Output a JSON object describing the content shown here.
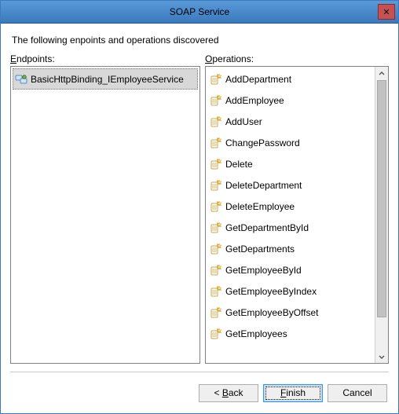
{
  "window": {
    "title": "SOAP Service"
  },
  "intro": "The following enpoints and operations discovered",
  "labels": {
    "endpoints_prefix": "E",
    "endpoints_rest": "ndpoints:",
    "operations_prefix": "O",
    "operations_rest": "perations:"
  },
  "endpoints": {
    "items": [
      {
        "label": "BasicHttpBinding_IEmployeeService",
        "selected": true
      }
    ]
  },
  "operations": {
    "items": [
      {
        "label": "AddDepartment"
      },
      {
        "label": "AddEmployee"
      },
      {
        "label": "AddUser"
      },
      {
        "label": "ChangePassword"
      },
      {
        "label": "Delete"
      },
      {
        "label": "DeleteDepartment"
      },
      {
        "label": "DeleteEmployee"
      },
      {
        "label": "GetDepartmentById"
      },
      {
        "label": "GetDepartments"
      },
      {
        "label": "GetEmployeeById"
      },
      {
        "label": "GetEmployeeByIndex"
      },
      {
        "label": "GetEmployeeByOffset"
      },
      {
        "label": "GetEmployees"
      }
    ]
  },
  "buttons": {
    "back_prefix": "< ",
    "back_u": "B",
    "back_rest": "ack",
    "finish_u": "F",
    "finish_rest": "inish",
    "cancel": "Cancel"
  }
}
